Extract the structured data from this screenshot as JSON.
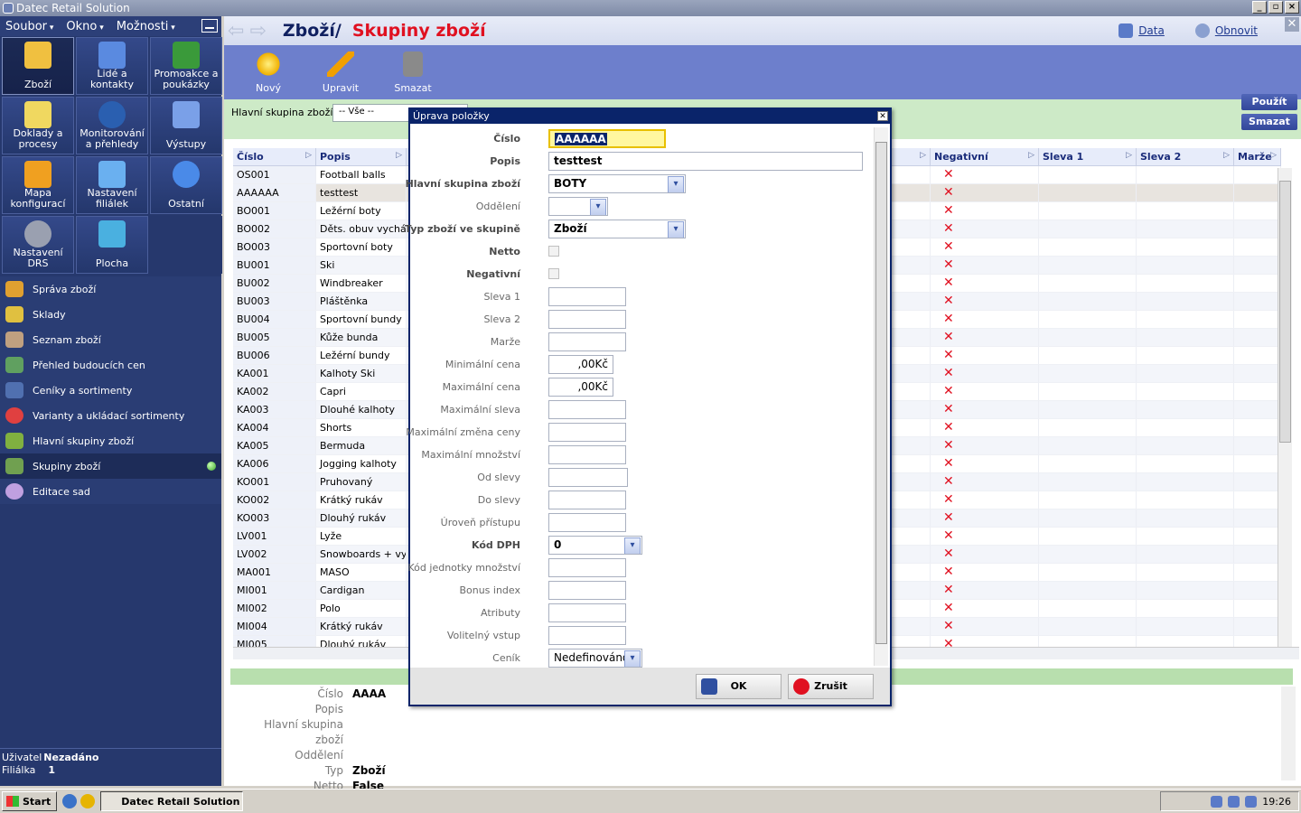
{
  "window": {
    "title": "Datec Retail Solution"
  },
  "menu": [
    "Soubor",
    "Okno",
    "Možnosti"
  ],
  "tiles": [
    {
      "label": "Zboží",
      "active": true
    },
    {
      "label": "Lidé a kontakty"
    },
    {
      "label": "Promoakce a poukázky"
    },
    {
      "label": "Doklady a procesy"
    },
    {
      "label": "Monitorování a přehledy"
    },
    {
      "label": "Výstupy"
    },
    {
      "label": "Mapa konfigurací"
    },
    {
      "label": "Nastavení filiálek"
    },
    {
      "label": "Ostatní"
    },
    {
      "label": "Nastavení DRS"
    },
    {
      "label": "Plocha"
    }
  ],
  "nav": [
    "Správa zboží",
    "Sklady",
    "Seznam zboží",
    "Přehled budoucích cen",
    "Ceníky a sortimenty",
    "Varianty a ukládací sortimenty",
    "Hlavní skupiny zboží",
    "Skupiny zboží",
    "Editace sad"
  ],
  "user": {
    "label_user": "Uživatel",
    "user": "Nezadáno",
    "label_branch": "Filiálka",
    "branch": "1"
  },
  "header": {
    "title_a": "Zboží/",
    "title_b": "Skupiny zboží",
    "link_data": "Data",
    "link_refresh": "Obnovit"
  },
  "toolbar": {
    "new": "Nový",
    "edit": "Upravit",
    "delete": "Smazat"
  },
  "filter": {
    "label": "Hlavní skupina zboží",
    "value": "-- Vše --",
    "apply": "Použít",
    "clear": "Smazat"
  },
  "grid": {
    "columns": [
      "Číslo",
      "Popis",
      "Negativní",
      "Sleva 1",
      "Sleva 2",
      "Marže"
    ],
    "rows": [
      [
        "OS001",
        "Football balls"
      ],
      [
        "AAAAAA",
        "testtest"
      ],
      [
        "BO001",
        "Ležérní boty"
      ],
      [
        "BO002",
        "Děts. obuv vychá..."
      ],
      [
        "BO003",
        "Sportovní boty"
      ],
      [
        "BU001",
        "Ski"
      ],
      [
        "BU002",
        "Windbreaker"
      ],
      [
        "BU003",
        "Pláštěnka"
      ],
      [
        "BU004",
        "Sportovní bundy"
      ],
      [
        "BU005",
        "Kůže bunda"
      ],
      [
        "BU006",
        "Ležérní bundy"
      ],
      [
        "KA001",
        "Kalhoty Ski"
      ],
      [
        "KA002",
        "Capri"
      ],
      [
        "KA003",
        "Dlouhé kalhoty"
      ],
      [
        "KA004",
        "Shorts"
      ],
      [
        "KA005",
        "Bermuda"
      ],
      [
        "KA006",
        "Jogging kalhoty"
      ],
      [
        "KO001",
        "Pruhovaný"
      ],
      [
        "KO002",
        "Krátký rukáv"
      ],
      [
        "KO003",
        "Dlouhý rukáv"
      ],
      [
        "LV001",
        "Lyže"
      ],
      [
        "LV002",
        "Snowboards + vy..."
      ],
      [
        "MA001",
        "MASO"
      ],
      [
        "MI001",
        "Cardigan"
      ],
      [
        "MI002",
        "Polo"
      ],
      [
        "MI004",
        "Krátký rukáv"
      ],
      [
        "MI005",
        "Dlouhý rukáv"
      ]
    ],
    "negative_mark": "✕"
  },
  "detail": [
    {
      "label": "Číslo",
      "value": "AAAA"
    },
    {
      "label": "Popis",
      "value": ""
    },
    {
      "label": "Hlavní skupina zboží",
      "value": ""
    },
    {
      "label": "Oddělení",
      "value": ""
    },
    {
      "label": "Typ",
      "value": "Zboží"
    },
    {
      "label": "Netto",
      "value": "False"
    }
  ],
  "modal": {
    "title": "Úprava položky",
    "fields": [
      {
        "label": "Číslo",
        "value": "AAAAAA",
        "bold": true
      },
      {
        "label": "Popis",
        "value": "testtest",
        "bold": true
      },
      {
        "label": "Hlavní skupina zboží",
        "value": "BOTY",
        "bold": true
      },
      {
        "label": "Oddělení",
        "value": ""
      },
      {
        "label": "Typ zboží ve skupině",
        "value": "Zboží",
        "bold": true
      },
      {
        "label": "Netto",
        "bold": true
      },
      {
        "label": "Negativní",
        "bold": true
      },
      {
        "label": "Sleva 1",
        "value": ""
      },
      {
        "label": "Sleva 2",
        "value": ""
      },
      {
        "label": "Marže",
        "value": ""
      },
      {
        "label": "Minimální cena",
        "value": ",00Kč"
      },
      {
        "label": "Maximální cena",
        "value": ",00Kč"
      },
      {
        "label": "Maximální sleva",
        "value": ""
      },
      {
        "label": "Maximální změna ceny",
        "value": ""
      },
      {
        "label": "Maximální množství",
        "value": ""
      },
      {
        "label": "Od slevy",
        "value": ""
      },
      {
        "label": "Do slevy",
        "value": ""
      },
      {
        "label": "Úroveň přístupu",
        "value": ""
      },
      {
        "label": "Kód DPH",
        "value": "0",
        "bold": true
      },
      {
        "label": "Kód jednotky množství",
        "value": ""
      },
      {
        "label": "Bonus index",
        "value": ""
      },
      {
        "label": "Atributy",
        "value": ""
      },
      {
        "label": "Volitelný vstup",
        "value": ""
      },
      {
        "label": "Ceník",
        "value": "Nedefinováno"
      }
    ],
    "ok": "OK",
    "cancel": "Zrušit"
  },
  "taskbar": {
    "start": "Start",
    "item": "Datec Retail Solution",
    "clock": "19:26"
  }
}
